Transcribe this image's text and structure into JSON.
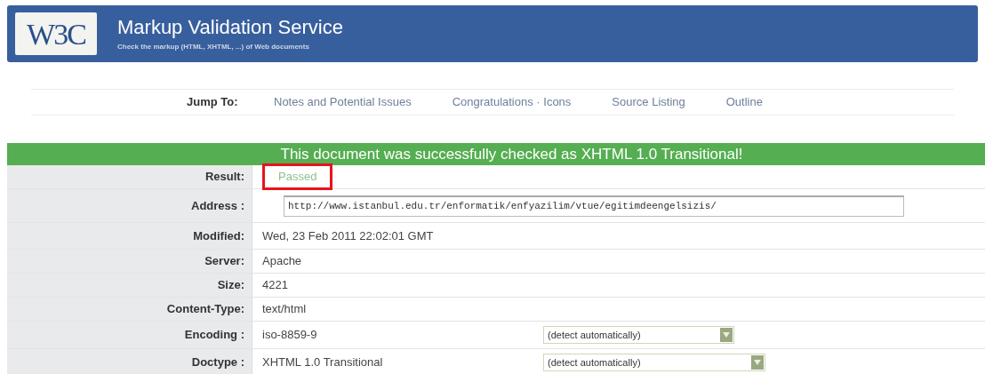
{
  "header": {
    "logo": "W3C",
    "title": "Markup Validation Service",
    "subtitle": "Check the markup (HTML, XHTML, ...) of Web documents"
  },
  "jump": {
    "label": "Jump To:",
    "links": [
      "Notes and Potential Issues",
      "Congratulations · Icons",
      "Source Listing",
      "Outline"
    ]
  },
  "banner": "This document was successfully checked as XHTML 1.0 Transitional!",
  "rows": [
    {
      "label": "Result:",
      "kind": "result",
      "value": "Passed",
      "highlighted": true
    },
    {
      "label": "Address :",
      "kind": "field",
      "value": "http://www.istanbul.edu.tr/enformatik/enfyazilim/vtue/egitimdeengelsizis/"
    },
    {
      "label": "Modified:",
      "kind": "text",
      "value": "Wed, 23 Feb 2011 22:02:01 GMT"
    },
    {
      "label": "Server:",
      "kind": "text",
      "value": "Apache"
    },
    {
      "label": "Size:",
      "kind": "text",
      "value": "4221"
    },
    {
      "label": "Content-Type:",
      "kind": "text",
      "value": "text/html"
    },
    {
      "label": "Encoding :",
      "kind": "select",
      "value": "iso-8859-9",
      "option": "(detect automatically)"
    },
    {
      "label": "Doctype :",
      "kind": "select",
      "value": "XHTML 1.0 Transitional",
      "option": "(detect automatically)"
    }
  ]
}
